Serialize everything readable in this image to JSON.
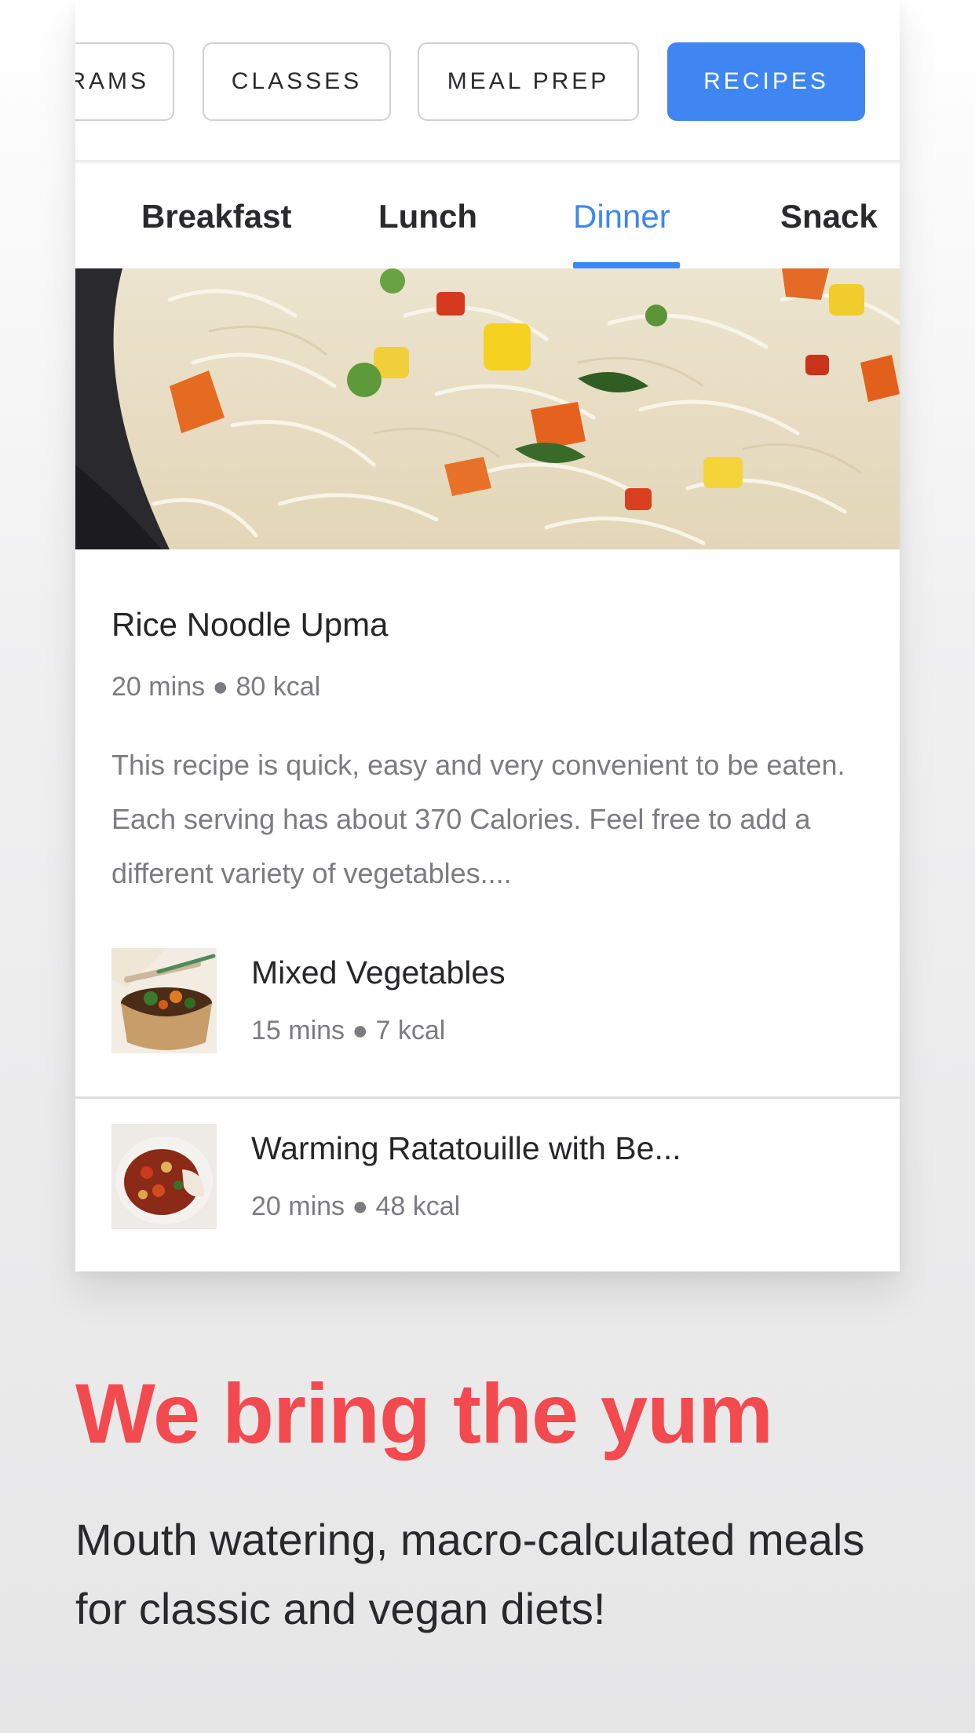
{
  "categories": {
    "items": [
      {
        "label": "RAMS",
        "active": false
      },
      {
        "label": "CLASSES",
        "active": false
      },
      {
        "label": "MEAL PREP",
        "active": false
      },
      {
        "label": "RECIPES",
        "active": true
      }
    ]
  },
  "meal_tabs": {
    "items": [
      {
        "label": "Breakfast"
      },
      {
        "label": "Lunch"
      },
      {
        "label": "Dinner",
        "active": true
      },
      {
        "label": "Snack"
      }
    ]
  },
  "featured": {
    "title": "Rice Noodle Upma",
    "meta": "20 mins ● 80 kcal",
    "description": "This recipe is quick, easy and very convenient to be eaten. Each serving has about 370 Calories. Feel free to add a different variety of vegetables...."
  },
  "recipes": [
    {
      "title": "Mixed Vegetables",
      "meta": "15 mins ● 7 kcal"
    },
    {
      "title": "Warming Ratatouille with Be...",
      "meta": "20 mins ● 48 kcal"
    }
  ],
  "marketing": {
    "headline": "We bring the yum",
    "subtext": "Mouth watering, macro-calculated meals for classic and vegan diets!"
  },
  "colors": {
    "accent": "#3f86f3",
    "headline": "#f24a4f"
  }
}
